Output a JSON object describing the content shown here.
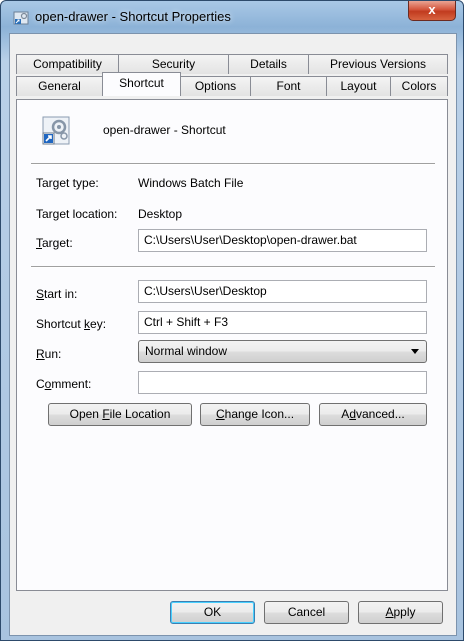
{
  "window": {
    "title": "open-drawer - Shortcut Properties",
    "close_label": "x"
  },
  "tabs_row1": [
    {
      "label": "Compatibility"
    },
    {
      "label": "Security"
    },
    {
      "label": "Details"
    },
    {
      "label": "Previous Versions"
    }
  ],
  "tabs_row2": [
    {
      "label": "General"
    },
    {
      "label": "Shortcut",
      "active": true
    },
    {
      "label": "Options"
    },
    {
      "label": "Font"
    },
    {
      "label": "Layout"
    },
    {
      "label": "Colors"
    }
  ],
  "shortcut": {
    "name": "open-drawer - Shortcut",
    "target_type_label": "Target type:",
    "target_type_value": "Windows Batch File",
    "target_location_label": "Target location:",
    "target_location_value": "Desktop",
    "target_label_ul": "T",
    "target_label_rest": "arget:",
    "target_value": "C:\\Users\\User\\Desktop\\open-drawer.bat",
    "start_in_label_ul": "S",
    "start_in_label_rest": "tart in:",
    "start_in_value": "C:\\Users\\User\\Desktop",
    "shortcut_key_label_pre": "Shortcut ",
    "shortcut_key_label_ul": "k",
    "shortcut_key_label_rest": "ey:",
    "shortcut_key_value": "Ctrl + Shift + F3",
    "run_label_ul": "R",
    "run_label_rest": "un:",
    "run_value": "Normal window",
    "comment_label_pre": "C",
    "comment_label_ul": "o",
    "comment_label_rest": "mment:",
    "comment_value": ""
  },
  "action_buttons": {
    "open_file_location": {
      "pre": "Open ",
      "ul": "F",
      "rest": "ile Location"
    },
    "change_icon": {
      "pre": "",
      "ul": "C",
      "rest": "hange Icon..."
    },
    "advanced": {
      "pre": "A",
      "ul": "d",
      "rest": "vanced..."
    }
  },
  "footer": {
    "ok": "OK",
    "cancel": "Cancel",
    "apply_ul": "A",
    "apply_rest": "pply"
  }
}
